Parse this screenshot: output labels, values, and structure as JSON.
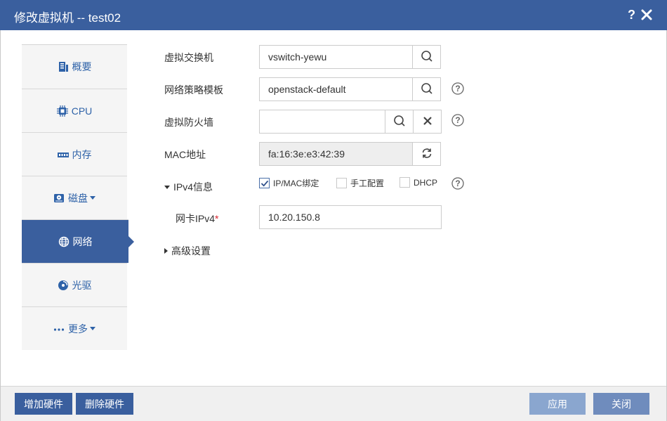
{
  "dialog": {
    "title": "修改虚拟机 -- test02",
    "help": "?"
  },
  "sidebar": {
    "items": [
      {
        "label": "概要",
        "icon": "summary-icon"
      },
      {
        "label": "CPU",
        "icon": "cpu-icon"
      },
      {
        "label": "内存",
        "icon": "memory-icon"
      },
      {
        "label": "磁盘",
        "icon": "disk-icon"
      },
      {
        "label": "网络",
        "icon": "globe-icon"
      },
      {
        "label": "光驱",
        "icon": "cdrom-icon"
      },
      {
        "label": "更多",
        "icon": "more-icon"
      }
    ],
    "active": "网络"
  },
  "form": {
    "vswitch": {
      "label": "虚拟交换机",
      "value": "vswitch-yewu"
    },
    "policy": {
      "label": "网络策略模板",
      "value": "openstack-default"
    },
    "firewall": {
      "label": "虚拟防火墙",
      "value": ""
    },
    "mac": {
      "label": "MAC地址",
      "value": "fa:16:3e:e3:42:39"
    },
    "ipv4": {
      "label": "IPv4信息",
      "options": [
        {
          "label": "IP/MAC绑定",
          "checked": true
        },
        {
          "label": "手工配置",
          "checked": false
        },
        {
          "label": "DHCP",
          "checked": false
        }
      ]
    },
    "nic_ipv4": {
      "label": "网卡IPv4",
      "required_mark": "*",
      "value": "10.20.150.8"
    },
    "advanced": {
      "label": "高级设置"
    }
  },
  "footer": {
    "add_hardware": "增加硬件",
    "remove_hardware": "删除硬件",
    "apply": "应用",
    "close": "关闭"
  },
  "colors": {
    "accent": "#3a5f9e",
    "link": "#2e62a8",
    "apply_disabled": "#8aa6cf",
    "close_button": "#6f8cbd"
  }
}
